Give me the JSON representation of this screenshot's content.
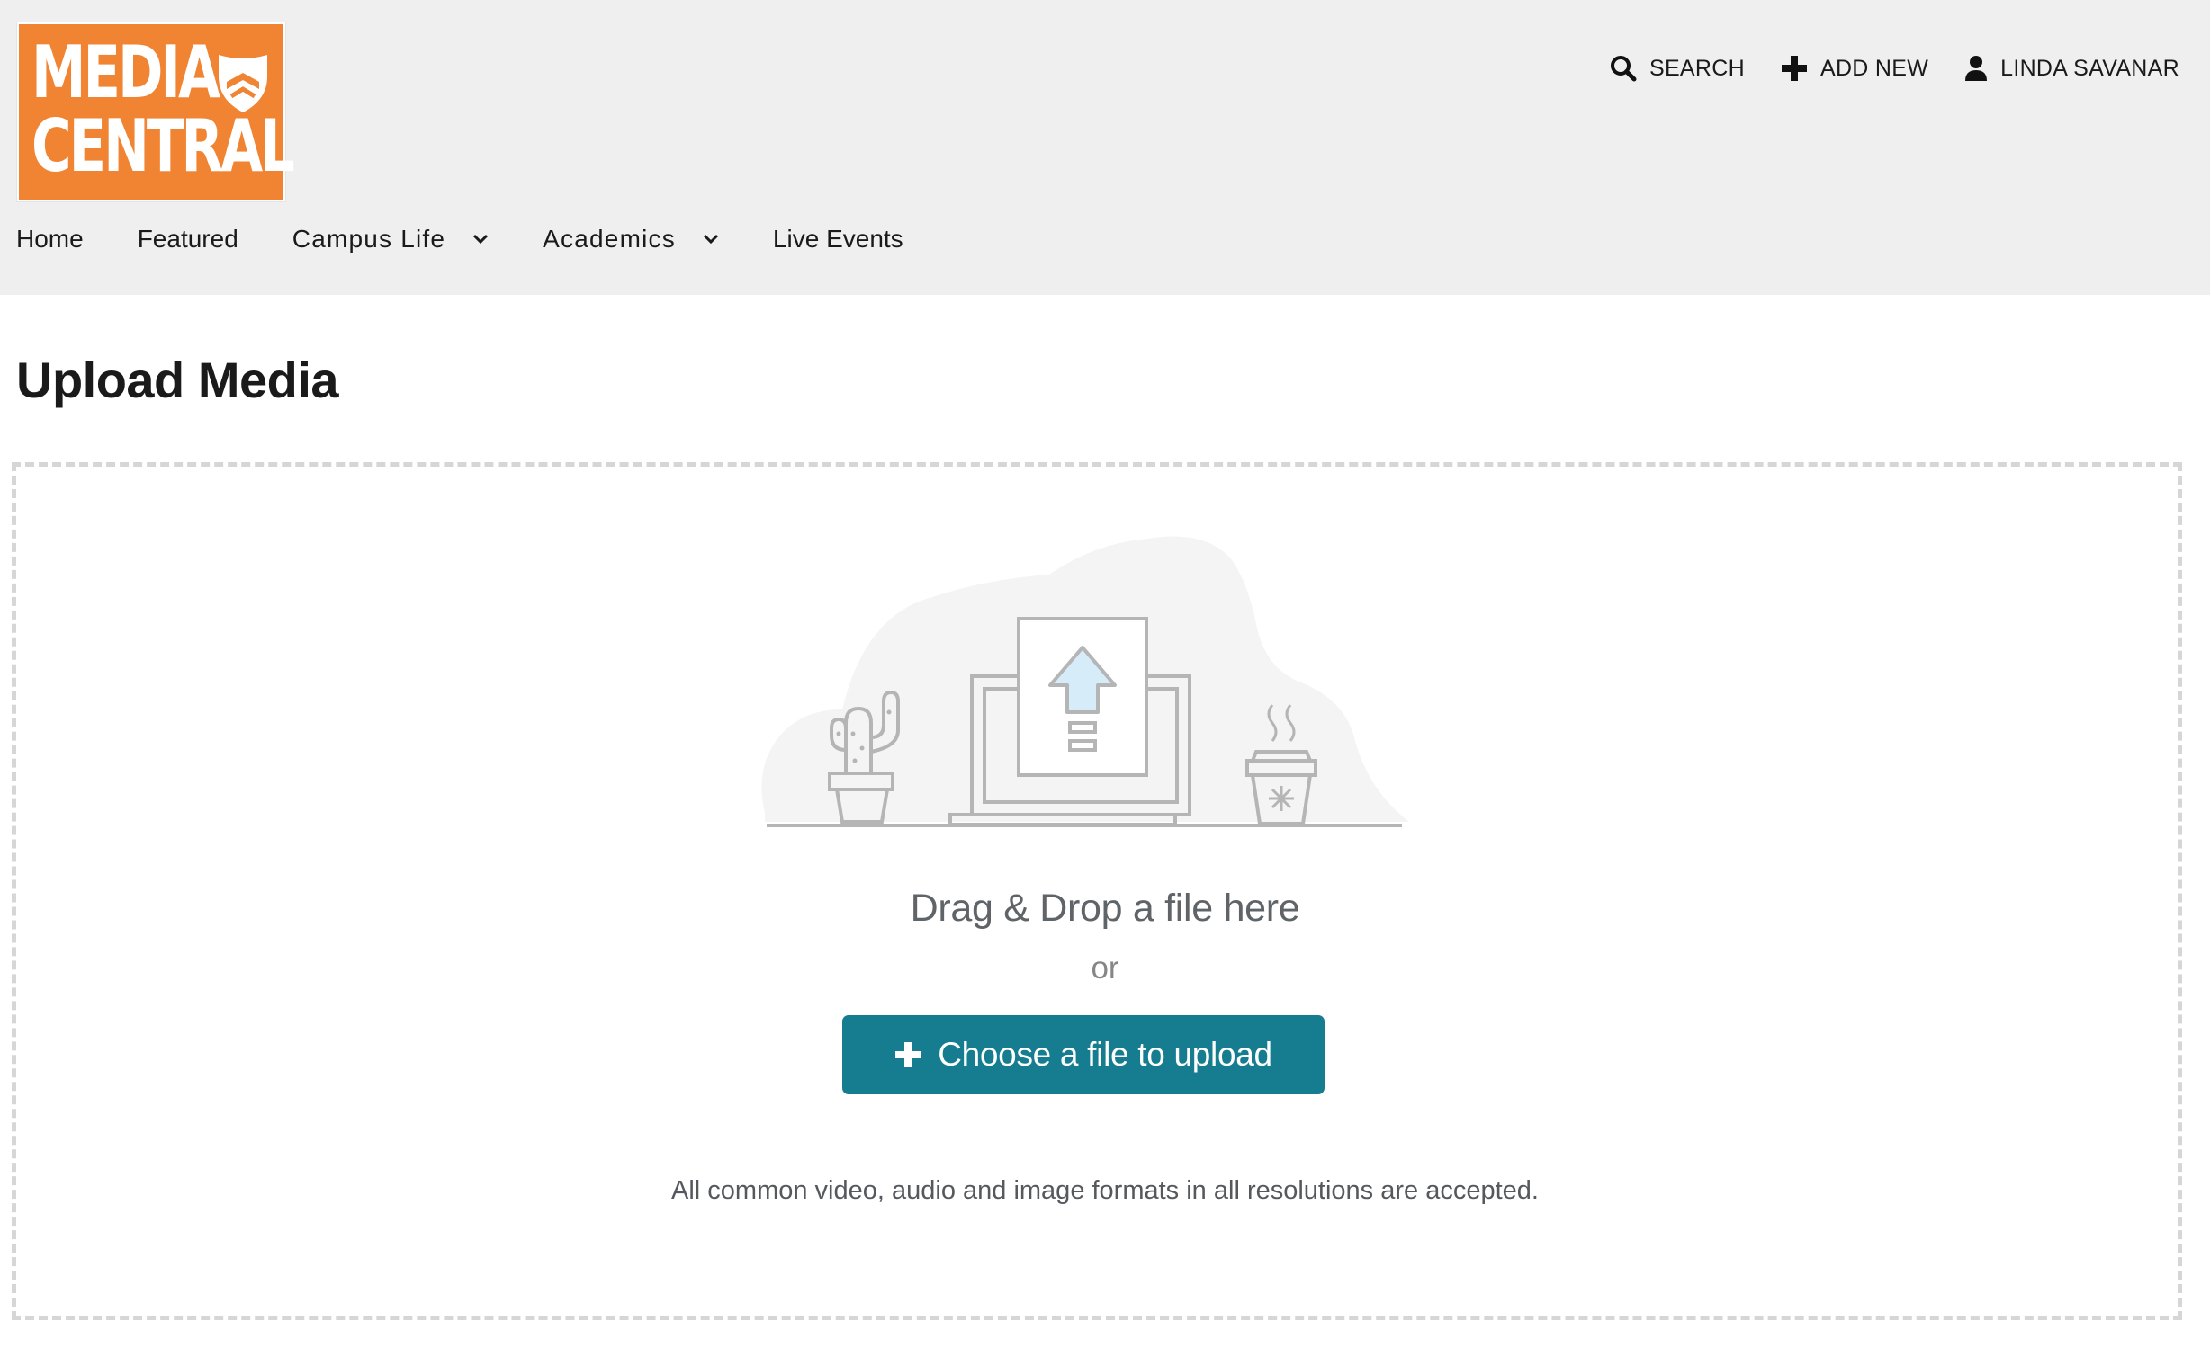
{
  "logo": {
    "line1": "MEDIA",
    "line2": "CENTRAL",
    "brand_color": "#f08432",
    "icon": "shield-icon"
  },
  "top_actions": {
    "search": {
      "label": "SEARCH",
      "icon": "search-icon"
    },
    "add_new": {
      "label": "ADD NEW",
      "icon": "plus-icon"
    },
    "user": {
      "label": "LINDA SAVANAR",
      "icon": "user-icon"
    }
  },
  "nav": {
    "items": [
      {
        "label": "Home"
      },
      {
        "label": "Featured"
      },
      {
        "label": "Campus Life",
        "has_dropdown": true
      },
      {
        "label": "Academics",
        "has_dropdown": true
      },
      {
        "label": "Live Events"
      }
    ]
  },
  "page": {
    "title": "Upload Media"
  },
  "dropzone": {
    "drag_text": "Drag & Drop a file here",
    "or_text": "or",
    "button_label": "Choose a file to upload",
    "button_icon": "plus-icon",
    "button_color": "#157d8f",
    "formats_text": "All common video, audio and image formats in all resolutions are accepted.",
    "illustration_icon": "upload-illustration-icon"
  }
}
